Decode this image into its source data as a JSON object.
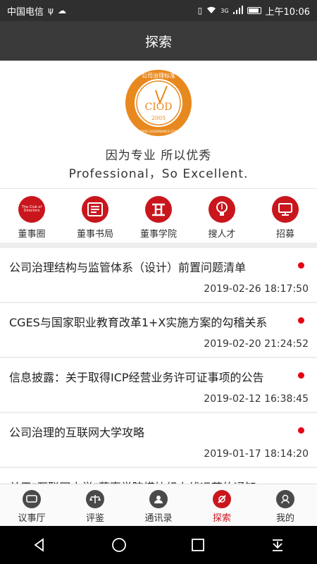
{
  "status_bar": {
    "carrier": "中国电信",
    "time": "上午10:06",
    "network": "3G",
    "icons": [
      "usb-icon",
      "cloud-icon",
      "vibrate-icon",
      "wifi-icon",
      "signal-icon",
      "battery-icon"
    ]
  },
  "header": {
    "title": "探索"
  },
  "banner": {
    "logo_top_text": "公司治理标准",
    "logo_ring_text": "CORPORATE GOVERNANCE STANDARD",
    "logo_center": "CIOD",
    "logo_year": "2005",
    "slogan_cn": "因为专业  所以优秀",
    "slogan_en": "Professional，So Excellent."
  },
  "shortcuts": [
    {
      "label": "董事圈",
      "icon": "club-of-directors-icon",
      "icon_text": "The Club of Directors"
    },
    {
      "label": "董事书局",
      "icon": "newspaper-icon"
    },
    {
      "label": "董事学院",
      "icon": "academy-icon"
    },
    {
      "label": "搜人才",
      "icon": "lightbulb-icon"
    },
    {
      "label": "招募",
      "icon": "monitor-icon"
    }
  ],
  "news": [
    {
      "title": "公司治理结构与监管体系（设计）前置问题清单",
      "date": "2019-02-26 18:17:50",
      "unread": true
    },
    {
      "title": "CGES与国家职业教育改革1+X实施方案的勾稽关系",
      "date": "2019-02-20 21:24:52",
      "unread": true
    },
    {
      "title": "信息披露：关于取得ICP经营业务许可证事项的公告",
      "date": "2019-02-12 16:38:45",
      "unread": true
    },
    {
      "title": "公司治理的互联网大学攻略",
      "date": "2019-01-17 18:14:20",
      "unread": true
    },
    {
      "title": "关于\"互联网大学\"董事学院模块组上线运营的通知",
      "date": "",
      "unread": false
    }
  ],
  "tabs": [
    {
      "label": "议事厅",
      "icon": "tv-icon",
      "active": false
    },
    {
      "label": "评鉴",
      "icon": "scale-icon",
      "active": false
    },
    {
      "label": "通讯录",
      "icon": "contacts-icon",
      "active": false
    },
    {
      "label": "探索",
      "icon": "explore-icon",
      "active": true
    },
    {
      "label": "我的",
      "icon": "profile-icon",
      "active": false
    }
  ],
  "colors": {
    "brand_red": "#c9161d",
    "header_bg": "#3a3a3a",
    "dot_red": "#e60012"
  }
}
